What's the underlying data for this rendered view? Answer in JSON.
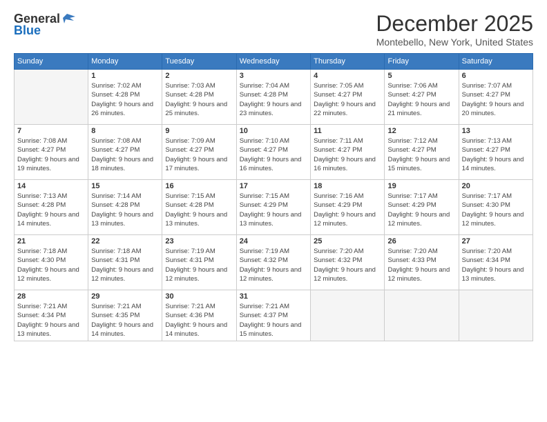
{
  "logo": {
    "general": "General",
    "blue": "Blue"
  },
  "title": "December 2025",
  "location": "Montebello, New York, United States",
  "weekdays": [
    "Sunday",
    "Monday",
    "Tuesday",
    "Wednesday",
    "Thursday",
    "Friday",
    "Saturday"
  ],
  "weeks": [
    [
      {
        "day": "",
        "sunrise": "",
        "sunset": "",
        "daylight": "",
        "empty": true
      },
      {
        "day": "1",
        "sunrise": "Sunrise: 7:02 AM",
        "sunset": "Sunset: 4:28 PM",
        "daylight": "Daylight: 9 hours and 26 minutes."
      },
      {
        "day": "2",
        "sunrise": "Sunrise: 7:03 AM",
        "sunset": "Sunset: 4:28 PM",
        "daylight": "Daylight: 9 hours and 25 minutes."
      },
      {
        "day": "3",
        "sunrise": "Sunrise: 7:04 AM",
        "sunset": "Sunset: 4:28 PM",
        "daylight": "Daylight: 9 hours and 23 minutes."
      },
      {
        "day": "4",
        "sunrise": "Sunrise: 7:05 AM",
        "sunset": "Sunset: 4:27 PM",
        "daylight": "Daylight: 9 hours and 22 minutes."
      },
      {
        "day": "5",
        "sunrise": "Sunrise: 7:06 AM",
        "sunset": "Sunset: 4:27 PM",
        "daylight": "Daylight: 9 hours and 21 minutes."
      },
      {
        "day": "6",
        "sunrise": "Sunrise: 7:07 AM",
        "sunset": "Sunset: 4:27 PM",
        "daylight": "Daylight: 9 hours and 20 minutes."
      }
    ],
    [
      {
        "day": "7",
        "sunrise": "Sunrise: 7:08 AM",
        "sunset": "Sunset: 4:27 PM",
        "daylight": "Daylight: 9 hours and 19 minutes."
      },
      {
        "day": "8",
        "sunrise": "Sunrise: 7:08 AM",
        "sunset": "Sunset: 4:27 PM",
        "daylight": "Daylight: 9 hours and 18 minutes."
      },
      {
        "day": "9",
        "sunrise": "Sunrise: 7:09 AM",
        "sunset": "Sunset: 4:27 PM",
        "daylight": "Daylight: 9 hours and 17 minutes."
      },
      {
        "day": "10",
        "sunrise": "Sunrise: 7:10 AM",
        "sunset": "Sunset: 4:27 PM",
        "daylight": "Daylight: 9 hours and 16 minutes."
      },
      {
        "day": "11",
        "sunrise": "Sunrise: 7:11 AM",
        "sunset": "Sunset: 4:27 PM",
        "daylight": "Daylight: 9 hours and 16 minutes."
      },
      {
        "day": "12",
        "sunrise": "Sunrise: 7:12 AM",
        "sunset": "Sunset: 4:27 PM",
        "daylight": "Daylight: 9 hours and 15 minutes."
      },
      {
        "day": "13",
        "sunrise": "Sunrise: 7:13 AM",
        "sunset": "Sunset: 4:27 PM",
        "daylight": "Daylight: 9 hours and 14 minutes."
      }
    ],
    [
      {
        "day": "14",
        "sunrise": "Sunrise: 7:13 AM",
        "sunset": "Sunset: 4:28 PM",
        "daylight": "Daylight: 9 hours and 14 minutes."
      },
      {
        "day": "15",
        "sunrise": "Sunrise: 7:14 AM",
        "sunset": "Sunset: 4:28 PM",
        "daylight": "Daylight: 9 hours and 13 minutes."
      },
      {
        "day": "16",
        "sunrise": "Sunrise: 7:15 AM",
        "sunset": "Sunset: 4:28 PM",
        "daylight": "Daylight: 9 hours and 13 minutes."
      },
      {
        "day": "17",
        "sunrise": "Sunrise: 7:15 AM",
        "sunset": "Sunset: 4:29 PM",
        "daylight": "Daylight: 9 hours and 13 minutes."
      },
      {
        "day": "18",
        "sunrise": "Sunrise: 7:16 AM",
        "sunset": "Sunset: 4:29 PM",
        "daylight": "Daylight: 9 hours and 12 minutes."
      },
      {
        "day": "19",
        "sunrise": "Sunrise: 7:17 AM",
        "sunset": "Sunset: 4:29 PM",
        "daylight": "Daylight: 9 hours and 12 minutes."
      },
      {
        "day": "20",
        "sunrise": "Sunrise: 7:17 AM",
        "sunset": "Sunset: 4:30 PM",
        "daylight": "Daylight: 9 hours and 12 minutes."
      }
    ],
    [
      {
        "day": "21",
        "sunrise": "Sunrise: 7:18 AM",
        "sunset": "Sunset: 4:30 PM",
        "daylight": "Daylight: 9 hours and 12 minutes."
      },
      {
        "day": "22",
        "sunrise": "Sunrise: 7:18 AM",
        "sunset": "Sunset: 4:31 PM",
        "daylight": "Daylight: 9 hours and 12 minutes."
      },
      {
        "day": "23",
        "sunrise": "Sunrise: 7:19 AM",
        "sunset": "Sunset: 4:31 PM",
        "daylight": "Daylight: 9 hours and 12 minutes."
      },
      {
        "day": "24",
        "sunrise": "Sunrise: 7:19 AM",
        "sunset": "Sunset: 4:32 PM",
        "daylight": "Daylight: 9 hours and 12 minutes."
      },
      {
        "day": "25",
        "sunrise": "Sunrise: 7:20 AM",
        "sunset": "Sunset: 4:32 PM",
        "daylight": "Daylight: 9 hours and 12 minutes."
      },
      {
        "day": "26",
        "sunrise": "Sunrise: 7:20 AM",
        "sunset": "Sunset: 4:33 PM",
        "daylight": "Daylight: 9 hours and 12 minutes."
      },
      {
        "day": "27",
        "sunrise": "Sunrise: 7:20 AM",
        "sunset": "Sunset: 4:34 PM",
        "daylight": "Daylight: 9 hours and 13 minutes."
      }
    ],
    [
      {
        "day": "28",
        "sunrise": "Sunrise: 7:21 AM",
        "sunset": "Sunset: 4:34 PM",
        "daylight": "Daylight: 9 hours and 13 minutes."
      },
      {
        "day": "29",
        "sunrise": "Sunrise: 7:21 AM",
        "sunset": "Sunset: 4:35 PM",
        "daylight": "Daylight: 9 hours and 14 minutes."
      },
      {
        "day": "30",
        "sunrise": "Sunrise: 7:21 AM",
        "sunset": "Sunset: 4:36 PM",
        "daylight": "Daylight: 9 hours and 14 minutes."
      },
      {
        "day": "31",
        "sunrise": "Sunrise: 7:21 AM",
        "sunset": "Sunset: 4:37 PM",
        "daylight": "Daylight: 9 hours and 15 minutes."
      },
      {
        "day": "",
        "sunrise": "",
        "sunset": "",
        "daylight": "",
        "empty": true
      },
      {
        "day": "",
        "sunrise": "",
        "sunset": "",
        "daylight": "",
        "empty": true
      },
      {
        "day": "",
        "sunrise": "",
        "sunset": "",
        "daylight": "",
        "empty": true
      }
    ]
  ]
}
